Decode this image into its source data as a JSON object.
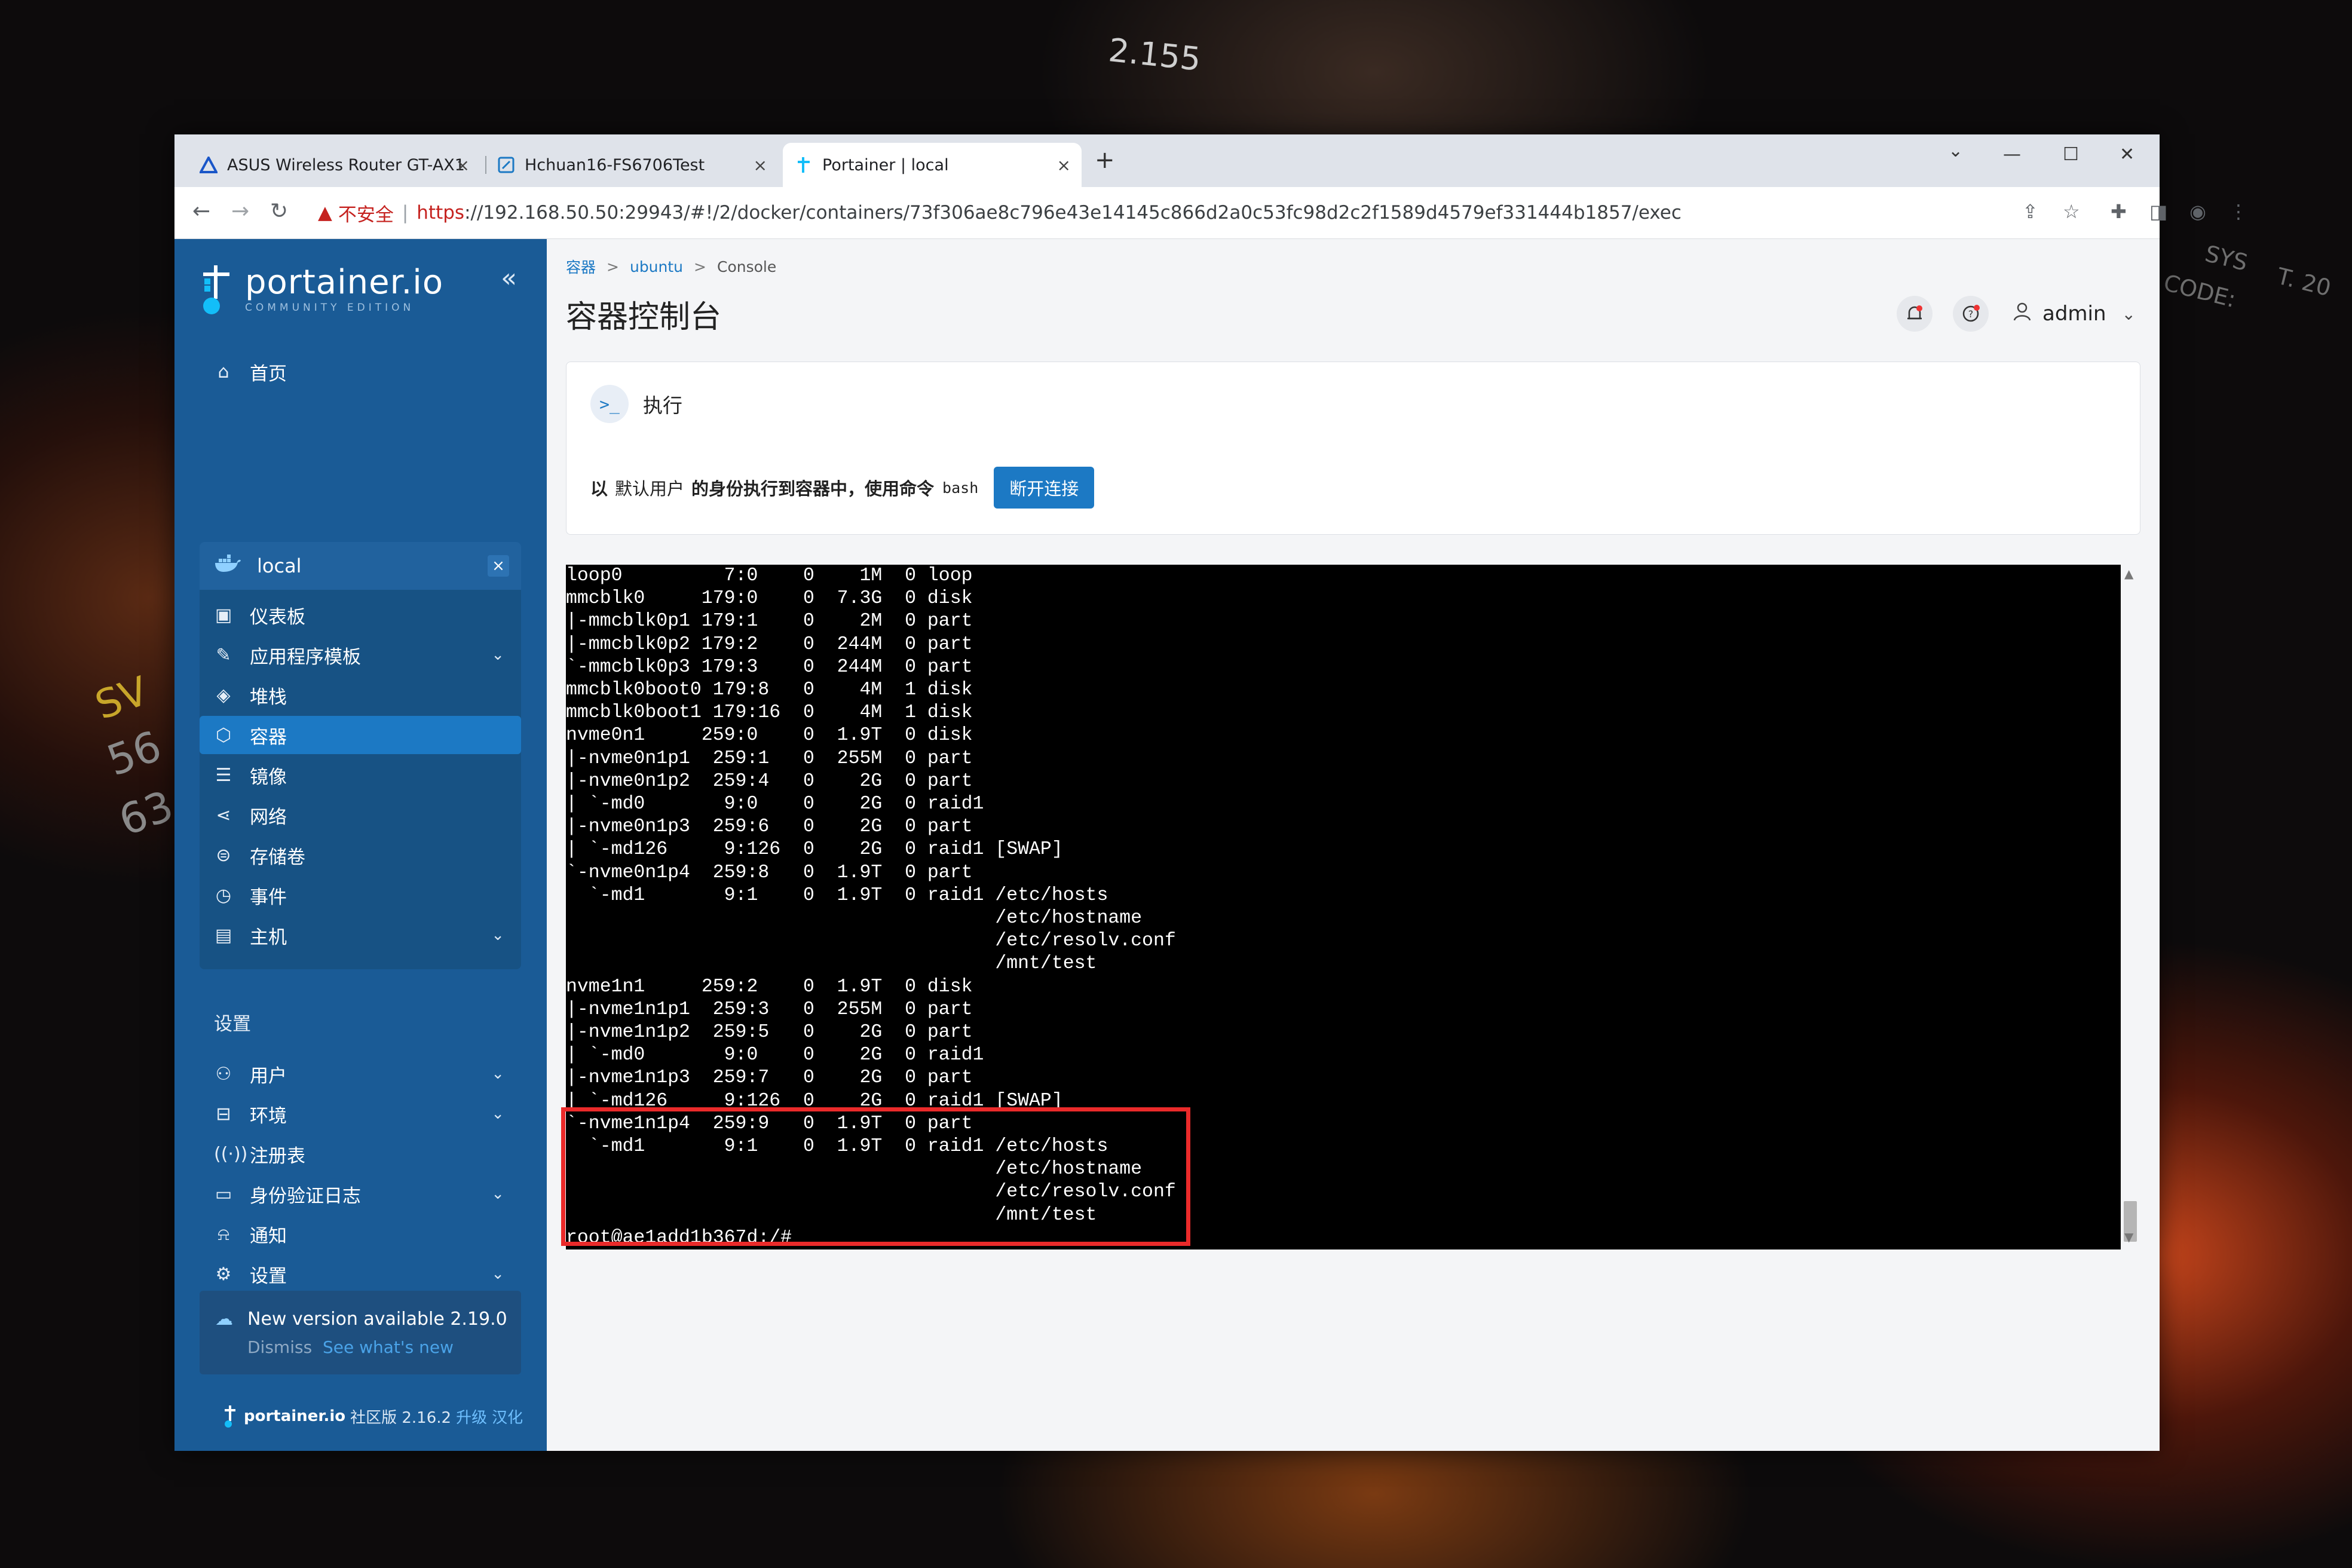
{
  "background": {
    "deco": [
      "2.155",
      "SYS",
      "T. 20",
      "CODE:",
      "SV",
      "56",
      "63"
    ]
  },
  "tabs": [
    {
      "title": "ASUS Wireless Router GT-AX1",
      "icon": "asus-icon",
      "close": "×"
    },
    {
      "title": "Hchuan16-FS6706Test",
      "icon": "nas-icon",
      "close": "×"
    },
    {
      "title": "Portainer | local",
      "icon": "portainer-icon",
      "close": "×",
      "active": true
    }
  ],
  "new_tab": "+",
  "window_controls": {
    "menu": "⌄",
    "minimize": "—",
    "maximize": "☐",
    "close": "✕"
  },
  "address": {
    "warning_icon": "▲",
    "insecure_label": "不安全",
    "separator": "|",
    "scheme": "https",
    "rest": "://192.168.50.50:29943/#!/2/docker/containers/73f306ae8c796e43e14145c866d2a0c53fc98d2c2f1589d4579ef331444b1857/exec"
  },
  "sidebar": {
    "brand": "portainer.io",
    "edition": "COMMUNITY EDITION",
    "collapse": "«",
    "home": "首页",
    "environment": {
      "name": "local",
      "close": "×"
    },
    "env_items": [
      {
        "label": "仪表板",
        "icon": "dashboard-icon"
      },
      {
        "label": "应用程序模板",
        "icon": "edit-icon",
        "chevron": true
      },
      {
        "label": "堆栈",
        "icon": "layers-icon"
      },
      {
        "label": "容器",
        "icon": "box-icon",
        "active": true
      },
      {
        "label": "镜像",
        "icon": "list-icon"
      },
      {
        "label": "网络",
        "icon": "share-icon"
      },
      {
        "label": "存储卷",
        "icon": "database-icon"
      },
      {
        "label": "事件",
        "icon": "clock-icon"
      },
      {
        "label": "主机",
        "icon": "host-icon",
        "chevron": true
      }
    ],
    "settings_heading": "设置",
    "settings_items": [
      {
        "label": "用户",
        "icon": "users-icon",
        "chevron": true
      },
      {
        "label": "环境",
        "icon": "hdd-icon",
        "chevron": true
      },
      {
        "label": "注册表",
        "icon": "radio-icon"
      },
      {
        "label": "身份验证日志",
        "icon": "file-icon",
        "chevron": true
      },
      {
        "label": "通知",
        "icon": "bell-icon"
      },
      {
        "label": "设置",
        "icon": "gear-icon",
        "chevron": true
      }
    ],
    "update": {
      "message": "New version available 2.19.0",
      "dismiss": "Dismiss",
      "whats_new": "See what's new"
    },
    "footer": {
      "brand": "portainer.io",
      "version": "社区版 2.16.2",
      "upgrade": "升级",
      "localize": "汉化"
    }
  },
  "main": {
    "breadcrumb": [
      "容器",
      "ubuntu",
      "Console"
    ],
    "breadcrumb_sep": ">",
    "title": "容器控制台",
    "user": "admin",
    "exec": {
      "title": "执行",
      "prefix": "以",
      "user": "默认用户",
      "middle": "的身份执行到容器中，使用命令",
      "command": "bash",
      "disconnect": "断开连接"
    },
    "terminal_lines": [
      "loop0         7:0    0    1M  0 loop",
      "mmcblk0     179:0    0  7.3G  0 disk",
      "|-mmcblk0p1 179:1    0    2M  0 part",
      "|-mmcblk0p2 179:2    0  244M  0 part",
      "`-mmcblk0p3 179:3    0  244M  0 part",
      "mmcblk0boot0 179:8   0    4M  1 disk",
      "mmcblk0boot1 179:16  0    4M  1 disk",
      "nvme0n1     259:0    0  1.9T  0 disk",
      "|-nvme0n1p1  259:1   0  255M  0 part",
      "|-nvme0n1p2  259:4   0    2G  0 part",
      "| `-md0       9:0    0    2G  0 raid1",
      "|-nvme0n1p3  259:6   0    2G  0 part",
      "| `-md126     9:126  0    2G  0 raid1 [SWAP]",
      "`-nvme0n1p4  259:8   0  1.9T  0 part",
      "  `-md1       9:1    0  1.9T  0 raid1 /etc/hosts",
      "                                      /etc/hostname",
      "                                      /etc/resolv.conf",
      "                                      /mnt/test",
      "nvme1n1     259:2    0  1.9T  0 disk",
      "|-nvme1n1p1  259:3   0  255M  0 part",
      "|-nvme1n1p2  259:5   0    2G  0 part",
      "| `-md0       9:0    0    2G  0 raid1",
      "|-nvme1n1p3  259:7   0    2G  0 part",
      "| `-md126     9:126  0    2G  0 raid1 [SWAP]",
      "`-nvme1n1p4  259:9   0  1.9T  0 part",
      "  `-md1       9:1    0  1.9T  0 raid1 /etc/hosts",
      "                                      /etc/hostname",
      "                                      /etc/resolv.conf",
      "                                      /mnt/test",
      "root@ae1add1b367d:/#"
    ]
  },
  "annotation_color": "#ea2a2a"
}
